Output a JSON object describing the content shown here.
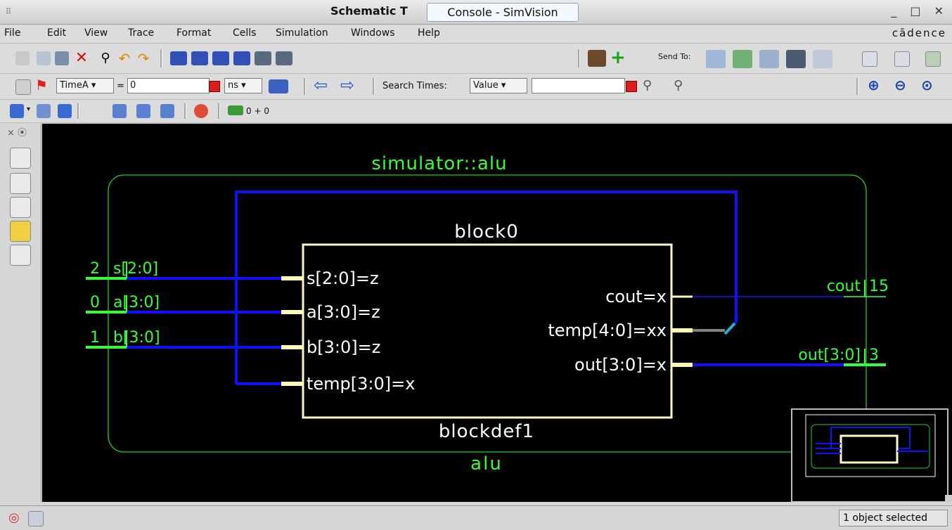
{
  "window": {
    "title": "Schematic T",
    "tooltip": "Console - SimVision"
  },
  "menu": {
    "items": [
      "File",
      "Edit",
      "View",
      "Trace",
      "Format",
      "Cells",
      "Simulation",
      "Windows",
      "Help"
    ],
    "brand": "cādence"
  },
  "toolbar1": {
    "send_to_label": "Send To:"
  },
  "toolbar2": {
    "time_name": "TimeA",
    "equals": "=",
    "time_value": "0",
    "time_unit": "ns",
    "search_label": "Search Times:",
    "search_mode": "Value",
    "search_value": ""
  },
  "toolbar3": {
    "sim_time": "0 + 0"
  },
  "schematic": {
    "instance_title": "simulator::alu",
    "module_label": "alu",
    "block_name": "block0",
    "block_def": "blockdef1",
    "inputs": [
      {
        "value": "2",
        "name": "s[2:0]",
        "port": "s[2:0]=z"
      },
      {
        "value": "0",
        "name": "a[3:0]",
        "port": "a[3:0]=z"
      },
      {
        "value": "1",
        "name": "b[3:0]",
        "port": "b[3:0]=z"
      }
    ],
    "temp_in_port": "temp[3:0]=x",
    "outputs": [
      {
        "port": "cout=x",
        "name": "cout",
        "value": "15"
      },
      {
        "port": "temp[4:0]=xx"
      },
      {
        "port": "out[3:0]=x",
        "name": "out[3:0]",
        "value": "3"
      }
    ],
    "colors": {
      "background": "#000000",
      "text": "#33ff33",
      "wire_bus": "#1010ff",
      "block_border": "#fff8c8",
      "pin": "#fffab0",
      "feedback_highlight": "#18b8c8"
    }
  },
  "status": {
    "message": "1 object selected"
  }
}
